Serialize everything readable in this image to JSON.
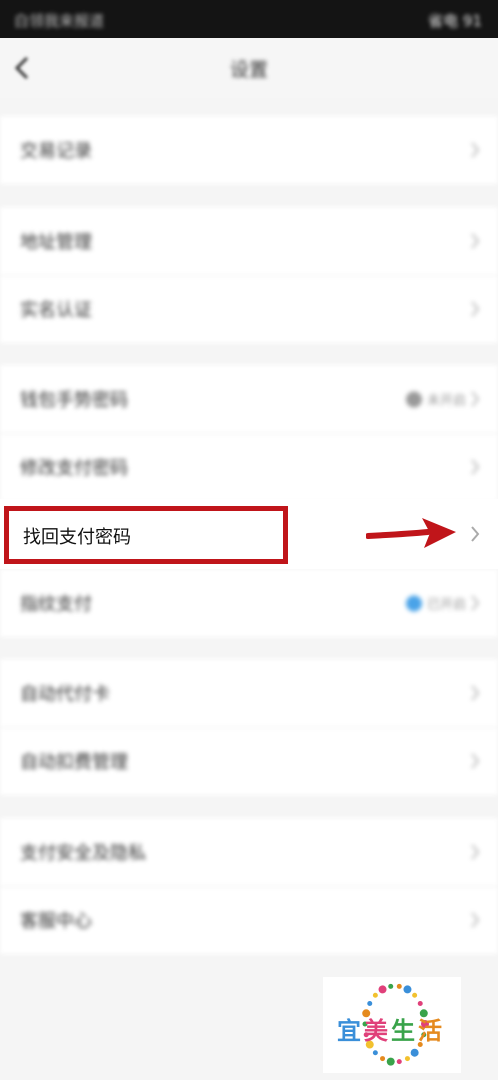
{
  "status_bar": {
    "left_text": "白领我来报道",
    "right_text": "省电 91"
  },
  "navbar": {
    "title": "设置",
    "back_icon": "chevron-left-icon"
  },
  "groups": [
    {
      "items": [
        {
          "label": "交易记录"
        }
      ]
    },
    {
      "items": [
        {
          "label": "地址管理"
        },
        {
          "label": "实名认证"
        }
      ]
    },
    {
      "items": [
        {
          "label": "钱包手势密码",
          "status": "未开启"
        },
        {
          "label": "修改支付密码"
        },
        {
          "label": "找回支付密码",
          "highlighted": true
        },
        {
          "label": "指纹支付",
          "status": "已开启"
        }
      ]
    },
    {
      "items": [
        {
          "label": "自动代付卡"
        },
        {
          "label": "自动扣费管理"
        }
      ]
    },
    {
      "items": [
        {
          "label": "支付安全及隐私"
        },
        {
          "label": "客服中心"
        }
      ]
    }
  ],
  "colors": {
    "highlight_red": "#c0151a",
    "status_blue": "#4aa3e8"
  },
  "watermark": {
    "text": [
      "宜",
      "美",
      "生",
      "活"
    ],
    "colors": [
      "#3a8fd9",
      "#e0407a",
      "#39a34a",
      "#e58a1e"
    ]
  }
}
